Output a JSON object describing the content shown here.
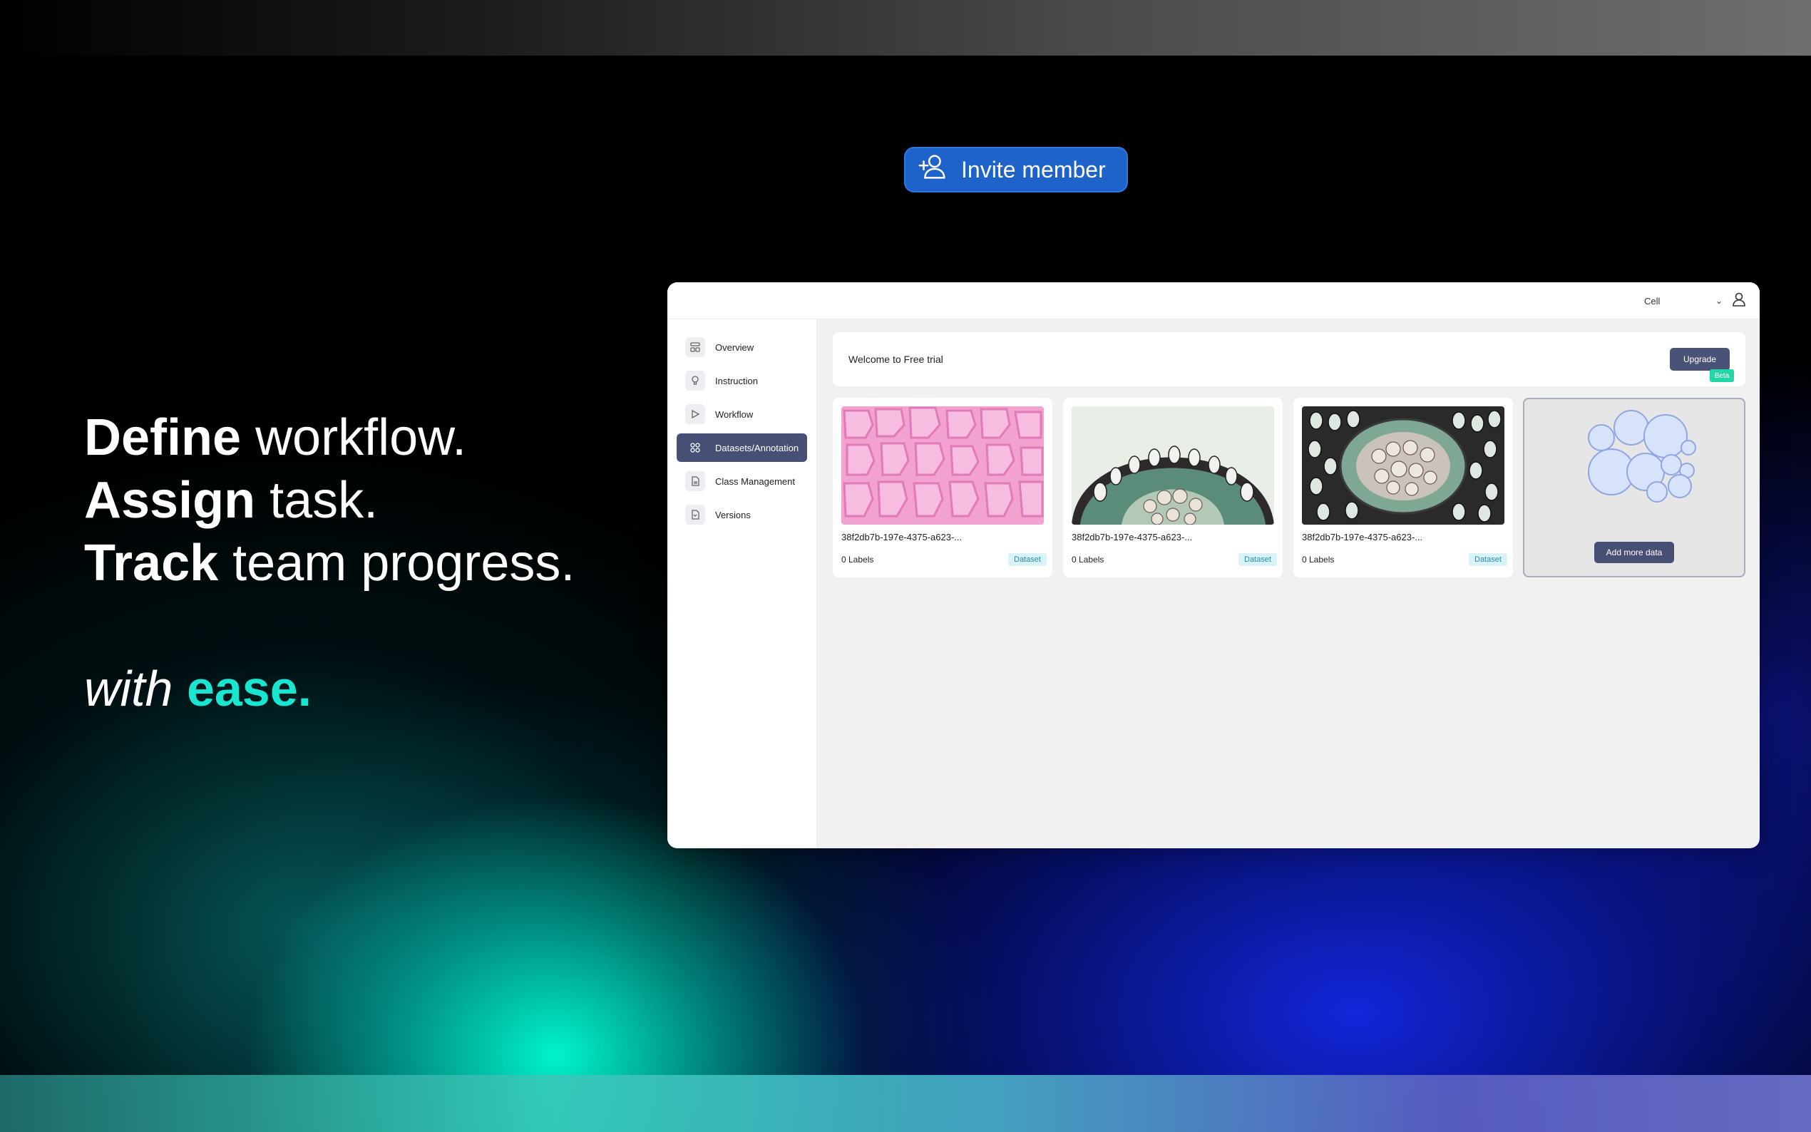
{
  "invite": {
    "label": "Invite member",
    "icon": "add-user-icon"
  },
  "headline": {
    "line1_bold": "Define",
    "line1_rest": "workflow.",
    "line2_bold": "Assign",
    "line2_rest": "task.",
    "line3_bold": "Track",
    "line3_rest": "team progress."
  },
  "tagline": {
    "with": "with",
    "ease": "ease."
  },
  "app": {
    "project_select": "Cell",
    "sidebar": {
      "items": [
        {
          "label": "Overview",
          "icon": "overview-icon"
        },
        {
          "label": "Instruction",
          "icon": "lightbulb-icon"
        },
        {
          "label": "Workflow",
          "icon": "play-icon"
        },
        {
          "label": "Datasets/Annotation",
          "icon": "grid-icon",
          "active": true
        },
        {
          "label": "Class Management",
          "icon": "document-icon"
        },
        {
          "label": "Versions",
          "icon": "versions-icon"
        }
      ]
    },
    "banner": {
      "text": "Welcome to Free trial",
      "upgrade": "Upgrade",
      "beta": "Beta"
    },
    "datasets": [
      {
        "name": "38f2db7b-197e-4375-a623-...",
        "labels": "0 Labels",
        "tag": "Dataset"
      },
      {
        "name": "38f2db7b-197e-4375-a623-...",
        "labels": "0 Labels",
        "tag": "Dataset"
      },
      {
        "name": "38f2db7b-197e-4375-a623-...",
        "labels": "0 Labels",
        "tag": "Dataset"
      }
    ],
    "add_more": "Add more data"
  },
  "colors": {
    "accent_teal": "#18e6d0",
    "invite_blue": "#1e63c9",
    "sidebar_active": "#474f74"
  }
}
